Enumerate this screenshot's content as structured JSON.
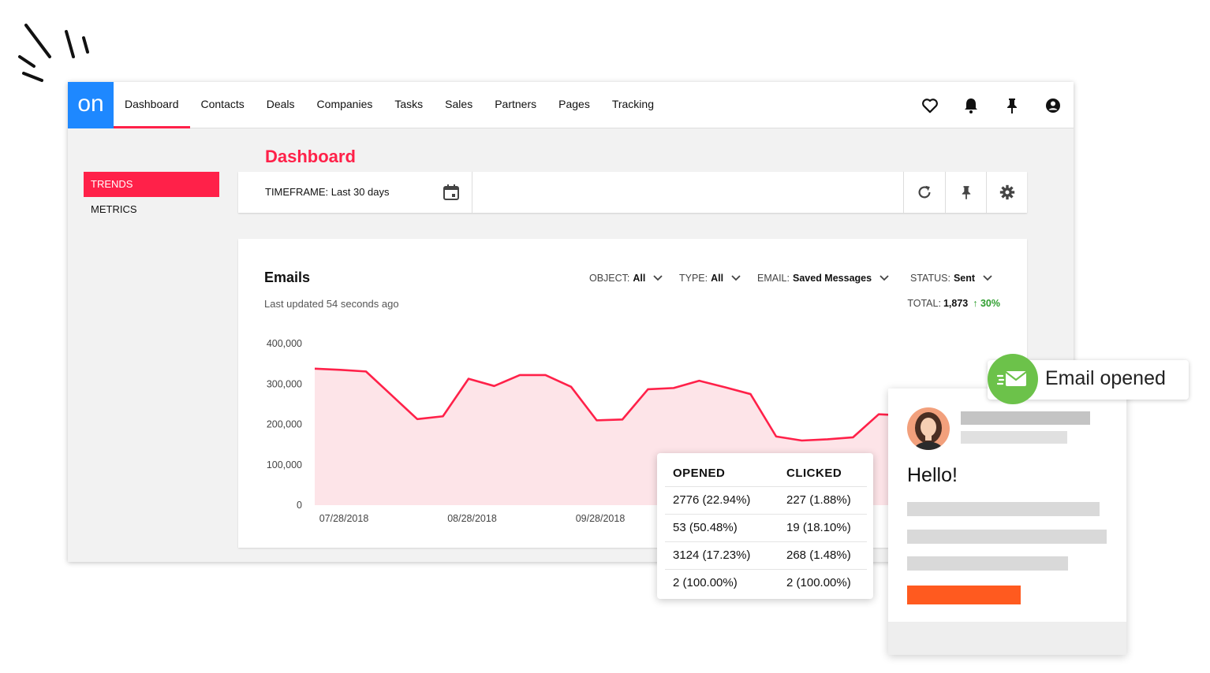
{
  "app": {
    "logo_text": "on",
    "nav": [
      "Dashboard",
      "Contacts",
      "Deals",
      "Companies",
      "Tasks",
      "Sales",
      "Partners",
      "Pages",
      "Tracking"
    ],
    "active_nav": "Dashboard",
    "nav_icons": [
      "heart-icon",
      "bell-icon",
      "pin-icon",
      "user-account-icon"
    ]
  },
  "sidebar": {
    "items": [
      {
        "label": "TRENDS",
        "active": true
      },
      {
        "label": "METRICS",
        "active": false
      }
    ]
  },
  "page": {
    "title": "Dashboard",
    "timeframe_label": "TIMEFRAME: Last 30 days",
    "toolbar_icons": [
      "calendar-icon",
      "refresh-icon",
      "pin-icon",
      "settings-icon"
    ]
  },
  "emails_card": {
    "title": "Emails",
    "subtitle": "Last updated 54 seconds ago",
    "filters": [
      {
        "label": "OBJECT:",
        "value": "All"
      },
      {
        "label": "TYPE:",
        "value": "All"
      },
      {
        "label": "EMAIL:",
        "value": "Saved Messages"
      },
      {
        "label": "STATUS:",
        "value": "Sent"
      }
    ],
    "total_label": "TOTAL:",
    "total_value": "1,873",
    "change": "30%",
    "colors": {
      "accent": "#ff2149",
      "area": "#fde4e8",
      "up": "#2e9e2e"
    }
  },
  "chart_data": {
    "type": "area",
    "x_ticks": [
      "07/28/2018",
      "08/28/2018",
      "09/28/2018"
    ],
    "y_ticks": [
      "0",
      "100,000",
      "200,000",
      "300,000",
      "400,000"
    ],
    "ylim": [
      0,
      400000
    ],
    "values": [
      338000,
      335000,
      331000,
      272000,
      213000,
      220000,
      313000,
      295000,
      322000,
      322000,
      293000,
      210000,
      212000,
      287000,
      290000,
      308000,
      292000,
      275000,
      170000,
      160000,
      163000,
      168000,
      225000,
      222000
    ]
  },
  "stats": {
    "headers": [
      "OPENED",
      "CLICKED"
    ],
    "rows": [
      [
        "2776 (22.94%)",
        "227 (1.88%)"
      ],
      [
        "53 (50.48%)",
        "19 (18.10%)"
      ],
      [
        "3124 (17.23%)",
        "268 (1.48%)"
      ],
      [
        "2 (100.00%)",
        "2 (100.00%)"
      ]
    ]
  },
  "email_preview": {
    "greeting": "Hello!",
    "toast": "Email opened",
    "colors": {
      "cta": "#ff5a1f",
      "badge": "#6cc24a"
    }
  }
}
